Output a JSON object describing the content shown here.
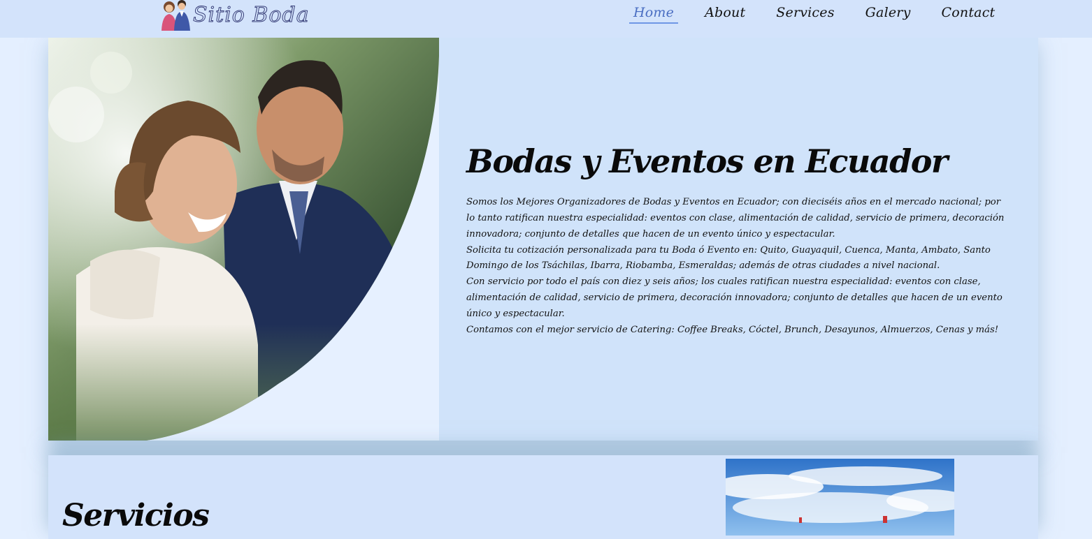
{
  "header": {
    "logo_text": "Sitio Boda",
    "nav": [
      {
        "label": "Home",
        "active": true
      },
      {
        "label": "About",
        "active": false
      },
      {
        "label": "Services",
        "active": false
      },
      {
        "label": "Galery",
        "active": false
      },
      {
        "label": "Contact",
        "active": false
      }
    ]
  },
  "hero": {
    "title": "Bodas y Eventos en Ecuador",
    "paragraphs": [
      "Somos los Mejores Organizadores de Bodas y Eventos en Ecuador; con dieciséis años en el mercado nacional; por lo tanto ratifican nuestra especialidad: eventos con clase, alimentación de calidad, servicio de primera, decoración innovadora; conjunto de detalles que hacen de un evento único y espectacular.",
      "Solicita tu cotización personalizada para tu Boda ó Evento en: Quito, Guayaquil, Cuenca, Manta, Ambato, Santo Domingo de los Tsáchilas, Ibarra, Riobamba, Esmeraldas; además de otras ciudades a nivel nacional.",
      "Con servicio por todo el país con diez y seis años; los cuales ratifican nuestra especialidad: eventos con clase, alimentación de calidad, servicio de primera, decoración innovadora; conjunto de detalles que hacen de un evento único y espectacular.",
      "Contamos con el mejor servicio de Catering: Coffee Breaks, Cóctel, Brunch, Desayunos, Almuerzos, Cenas y más!"
    ]
  },
  "services": {
    "title": "Servicios"
  },
  "colors": {
    "header_bg": "#d3e3fb",
    "page_bg": "#e4efff",
    "hero_bg": "#d0e3fa",
    "nav_active": "#4a6ec2",
    "nav_underline": "#6e97e6"
  }
}
